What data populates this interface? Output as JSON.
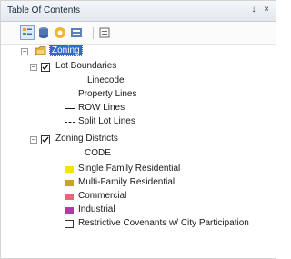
{
  "window": {
    "title": "Table Of Contents",
    "pin_glyph": "↓",
    "close_glyph": "×"
  },
  "toolbar": {
    "buttons": [
      {
        "icon": "list-by-drawing-order-icon",
        "active": true
      },
      {
        "icon": "list-by-source-icon",
        "active": false
      },
      {
        "icon": "list-by-visibility-icon",
        "active": false
      },
      {
        "icon": "list-by-selection-icon",
        "active": false
      },
      {
        "icon": "options-icon",
        "active": false
      }
    ]
  },
  "tree": {
    "group": {
      "label": "Zoning",
      "expanded": true
    },
    "layers": [
      {
        "name": "Lot Boundaries",
        "checked": true,
        "field": "Linecode",
        "legend": [
          {
            "label": "Property Lines",
            "style": "solid"
          },
          {
            "label": "ROW Lines",
            "style": "solid"
          },
          {
            "label": "Split Lot Lines",
            "style": "dashed"
          }
        ]
      },
      {
        "name": "Zoning Districts",
        "checked": true,
        "field": "CODE",
        "legend": [
          {
            "label": "Single Family Residential",
            "color": "#f2e600"
          },
          {
            "label": "Multi-Family Residential",
            "color": "#c9a227"
          },
          {
            "label": "Commercial",
            "color": "#e8657a"
          },
          {
            "label": "Industrial",
            "color": "#b03aa6"
          },
          {
            "label": "Restrictive Covenants w/ City Participation",
            "color": "#ffffff"
          }
        ]
      }
    ]
  }
}
